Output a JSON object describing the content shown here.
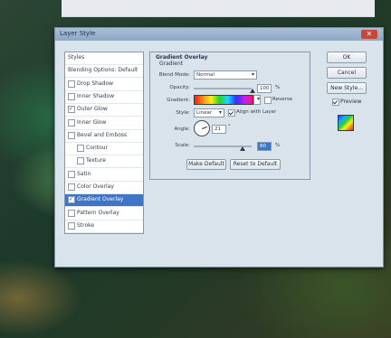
{
  "window": {
    "title": "Layer Style"
  },
  "styles_list": [
    {
      "label": "Styles",
      "checkbox": false,
      "checked": false,
      "selected": false
    },
    {
      "label": "Blending Options: Default",
      "checkbox": false,
      "checked": false,
      "selected": false
    },
    {
      "label": "Drop Shadow",
      "checkbox": true,
      "checked": false,
      "selected": false
    },
    {
      "label": "Inner Shadow",
      "checkbox": true,
      "checked": false,
      "selected": false
    },
    {
      "label": "Outer Glow",
      "checkbox": true,
      "checked": true,
      "selected": false
    },
    {
      "label": "Inner Glow",
      "checkbox": true,
      "checked": false,
      "selected": false
    },
    {
      "label": "Bevel and Emboss",
      "checkbox": true,
      "checked": false,
      "selected": false
    },
    {
      "label": "Contour",
      "checkbox": true,
      "checked": false,
      "selected": false,
      "indent": true
    },
    {
      "label": "Texture",
      "checkbox": true,
      "checked": false,
      "selected": false,
      "indent": true
    },
    {
      "label": "Satin",
      "checkbox": true,
      "checked": false,
      "selected": false
    },
    {
      "label": "Color Overlay",
      "checkbox": true,
      "checked": false,
      "selected": false
    },
    {
      "label": "Gradient Overlay",
      "checkbox": true,
      "checked": true,
      "selected": true
    },
    {
      "label": "Pattern Overlay",
      "checkbox": true,
      "checked": false,
      "selected": false
    },
    {
      "label": "Stroke",
      "checkbox": true,
      "checked": false,
      "selected": false
    }
  ],
  "panel": {
    "title": "Gradient Overlay",
    "subtitle": "Gradient",
    "blend_mode_label": "Blend Mode:",
    "blend_mode_value": "Normal",
    "opacity_label": "Opacity:",
    "opacity_value": "100",
    "opacity_unit": "%",
    "gradient_label": "Gradient:",
    "reverse_label": "Reverse",
    "reverse_checked": false,
    "style_label": "Style:",
    "style_value": "Linear",
    "align_label": "Align with Layer",
    "align_checked": true,
    "angle_label": "Angle:",
    "angle_value": "21",
    "angle_unit": "°",
    "scale_label": "Scale:",
    "scale_value": "80",
    "scale_unit": "%",
    "make_default_label": "Make Default",
    "reset_default_label": "Reset to Default"
  },
  "right_buttons": {
    "ok": "OK",
    "cancel": "Cancel",
    "new_style": "New Style...",
    "preview_label": "Preview",
    "preview_checked": true
  },
  "colors": {
    "selected_row": "#3d76c9",
    "titlebar": "#8ca7c4",
    "close_button": "#c9463a"
  },
  "icons": [
    "close-icon",
    "dropdown-arrow-icon",
    "angle-dial-icon",
    "style-preview-swatch-icon"
  ]
}
